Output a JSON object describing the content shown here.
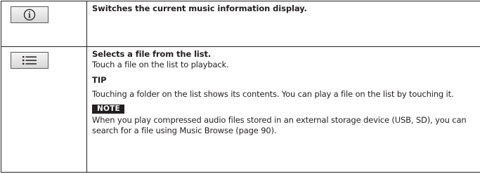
{
  "rows": [
    {
      "icon": "info-icon",
      "title": "Switches the current music information display."
    },
    {
      "icon": "list-icon",
      "title": "Selects a file from the list.",
      "text": "Touch a file on the list to playback.",
      "tip_label": "TIP",
      "tip_text": "Touching a folder on the list shows its contents. You can play a file on the list by touching it.",
      "note_label": "NOTE",
      "note_text": "When you play compressed audio files stored in an external storage device (USB, SD), you can search for a file using Music Browse (page 90)."
    }
  ],
  "colors": {
    "text": "#231f20",
    "border": "#231f20",
    "note_badge_bg": "#231f20",
    "note_badge_text": "#ffffff",
    "button_bg": "#e6e6e6"
  }
}
